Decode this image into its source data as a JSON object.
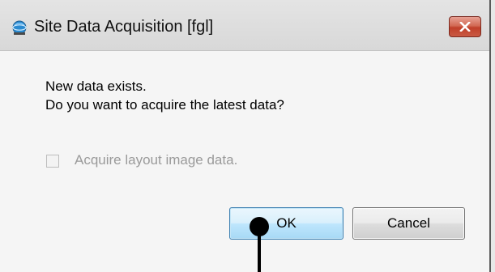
{
  "window": {
    "title": "Site Data Acquisition [fgl]"
  },
  "icons": {
    "app": "app-globe-icon",
    "close": "close-icon"
  },
  "message": {
    "line1": "New data exists.",
    "line2": "Do you want to acquire the latest data?"
  },
  "option": {
    "label": "Acquire layout image data.",
    "checked": false,
    "enabled": false
  },
  "buttons": {
    "ok": "OK",
    "cancel": "Cancel"
  },
  "colors": {
    "close_button": "#c95a44",
    "ok_border": "#3c7fb1",
    "disabled_text": "#9a9a9a"
  }
}
